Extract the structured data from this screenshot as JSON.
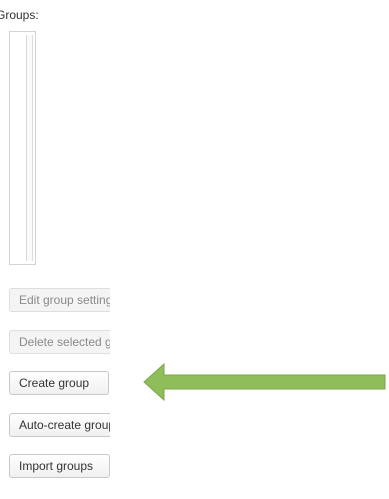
{
  "groups_panel": {
    "label": "Groups:"
  },
  "buttons": {
    "edit_group_settings": "Edit group settings",
    "delete_selected": "Delete selected group",
    "create_group": "Create group",
    "auto_create_groups": "Auto-create groups",
    "import_groups": "Import groups"
  },
  "colors": {
    "arrow": "#8fbd5a",
    "arrow_outline": "#7aa84a"
  }
}
